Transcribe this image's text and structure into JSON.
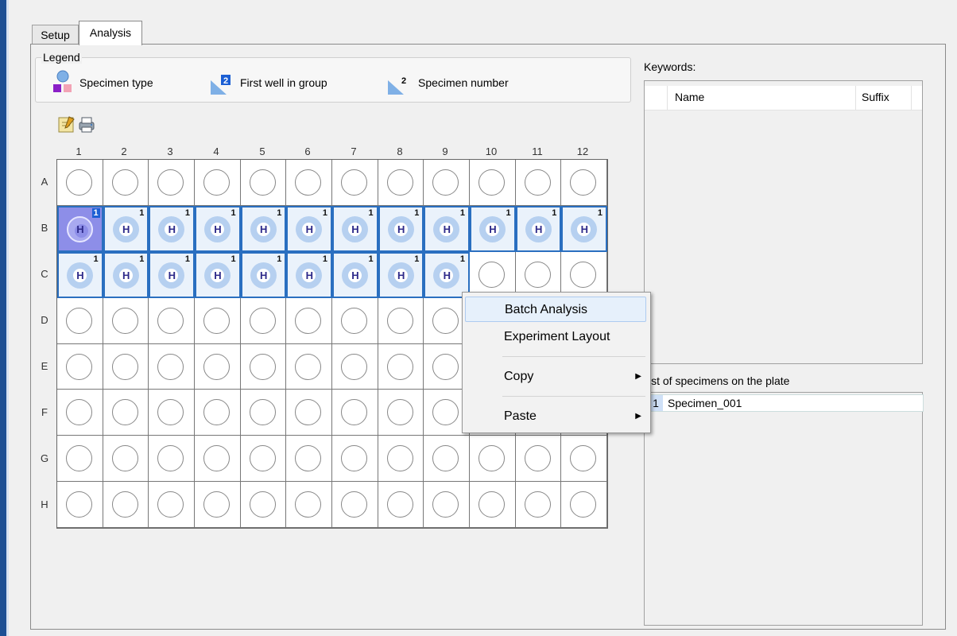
{
  "tabs": [
    {
      "label": "Setup"
    },
    {
      "label": "Analysis",
      "active": true
    }
  ],
  "legend": {
    "title": "Legend",
    "items": [
      {
        "label": "Specimen type",
        "icon": "specimen-type-icon"
      },
      {
        "label": "First well in group",
        "icon": "first-well-icon",
        "badge": "2"
      },
      {
        "label": "Specimen number",
        "icon": "specimen-number-icon",
        "badge": "2"
      }
    ]
  },
  "toolbar": {
    "icons": [
      "edit-icon",
      "print-icon"
    ]
  },
  "plate": {
    "columns": [
      "1",
      "2",
      "3",
      "4",
      "5",
      "6",
      "7",
      "8",
      "9",
      "10",
      "11",
      "12"
    ],
    "rows": [
      "A",
      "B",
      "C",
      "D",
      "E",
      "F",
      "G",
      "H"
    ],
    "well_symbol": "H",
    "specimen_number": "1",
    "filled_wells": {
      "B": [
        1,
        2,
        3,
        4,
        5,
        6,
        7,
        8,
        9,
        10,
        11,
        12
      ],
      "C": [
        1,
        2,
        3,
        4,
        5,
        6,
        7,
        8,
        9
      ]
    },
    "first_well": "B1"
  },
  "context_menu": {
    "items": [
      {
        "label": "Batch Analysis",
        "highlighted": true
      },
      {
        "label": "Experiment Layout"
      },
      {
        "label": "Copy",
        "submenu": true
      },
      {
        "label": "Paste",
        "submenu": true
      }
    ]
  },
  "keywords": {
    "label": "Keywords:",
    "columns": [
      "Name",
      "Suffix"
    ]
  },
  "specimens": {
    "label": "ist of specimens on the plate",
    "items": [
      {
        "index": "1",
        "name": "Specimen_001"
      }
    ]
  },
  "colors": {
    "accent": "#2a6fc0",
    "first_well": "#8d8ee8",
    "window_strip": "#1d4f94"
  }
}
